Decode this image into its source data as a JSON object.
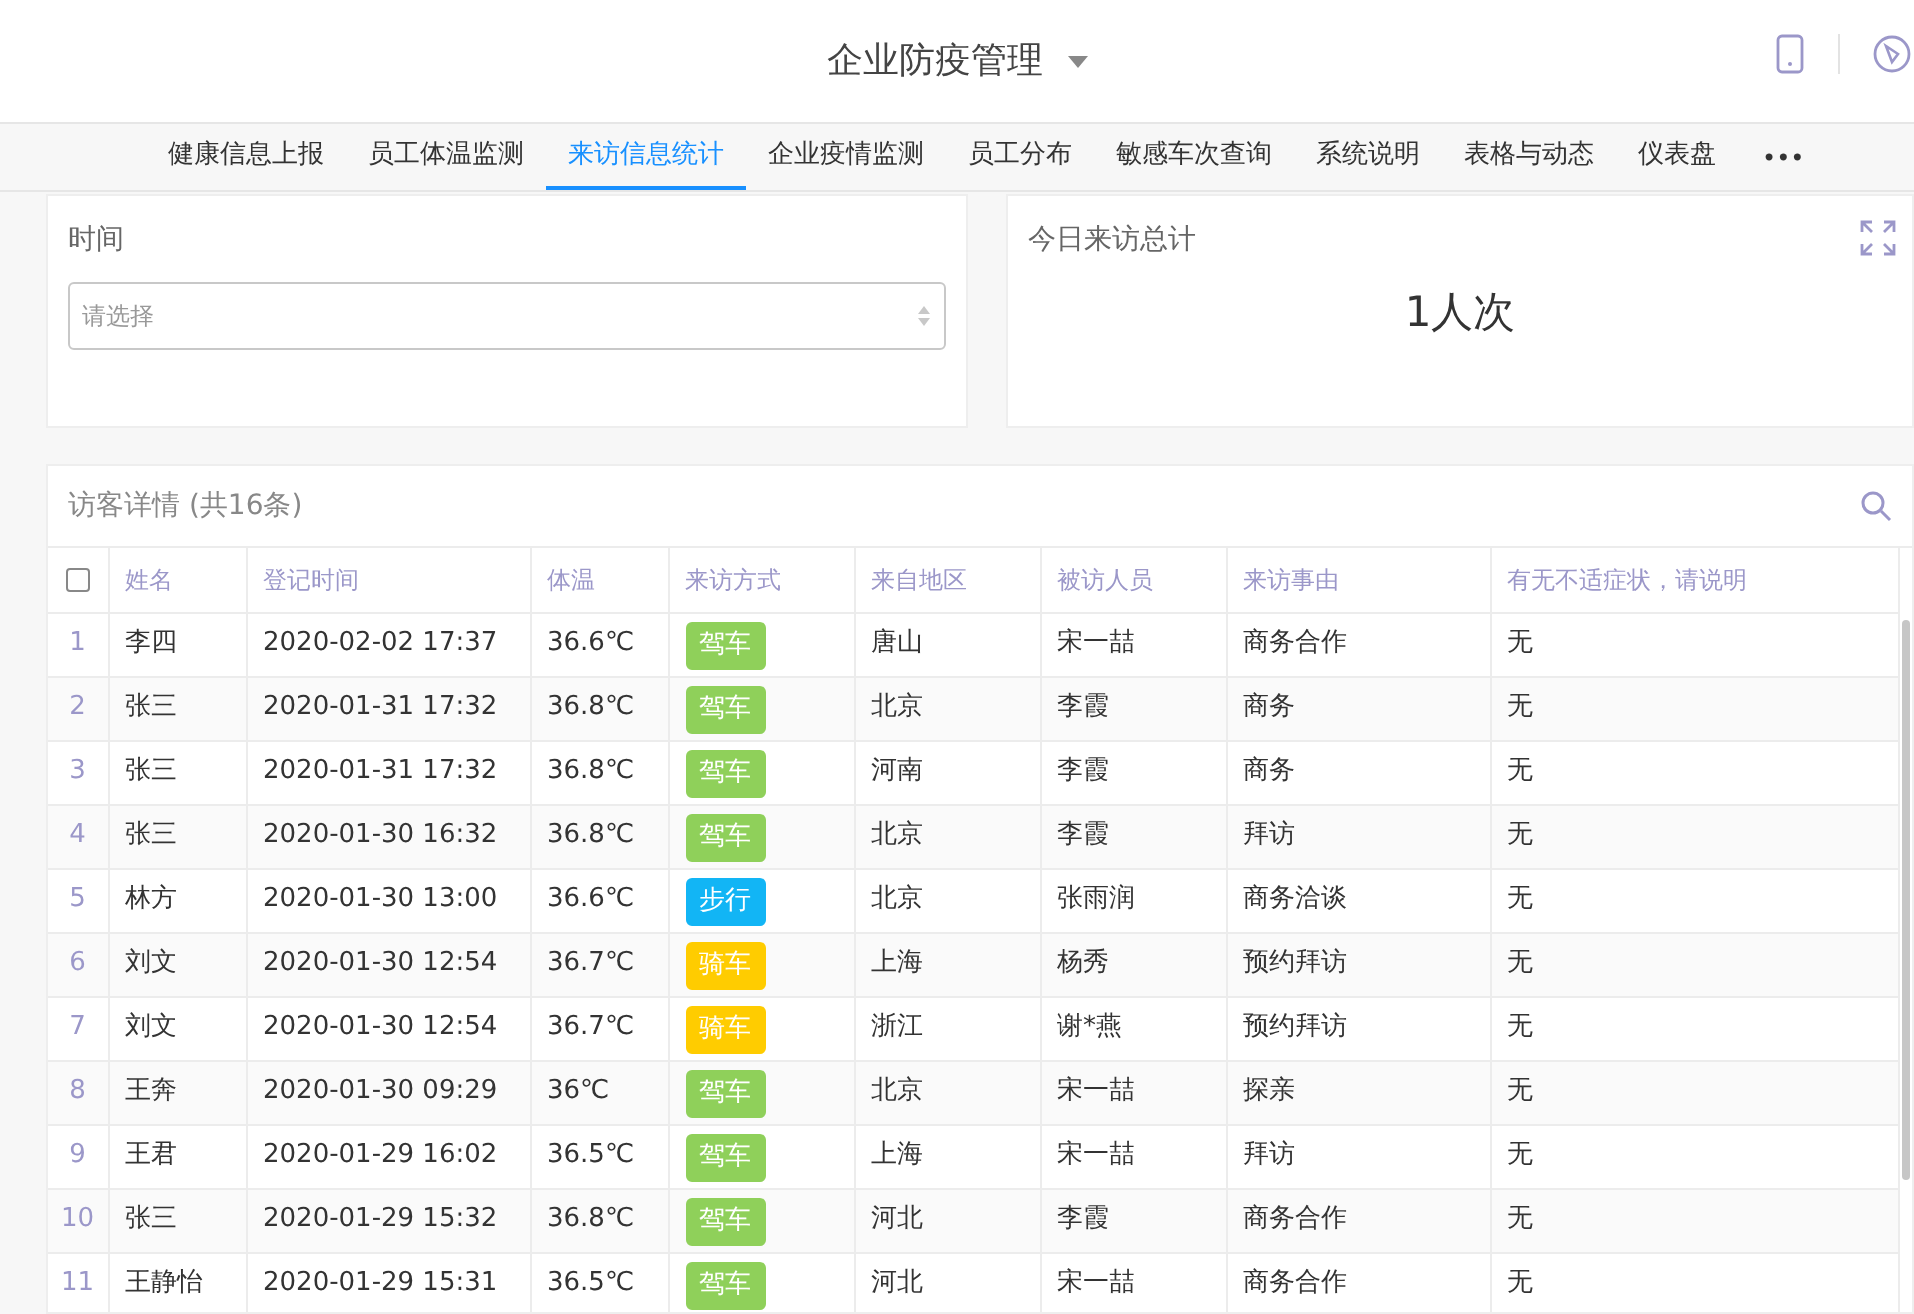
{
  "header": {
    "title": "企业防疫管理"
  },
  "tabs": [
    {
      "label": "健康信息上报",
      "selected": false
    },
    {
      "label": "员工体温监测",
      "selected": false
    },
    {
      "label": "来访信息统计",
      "selected": true
    },
    {
      "label": "企业疫情监测",
      "selected": false
    },
    {
      "label": "员工分布",
      "selected": false
    },
    {
      "label": "敏感车次查询",
      "selected": false
    },
    {
      "label": "系统说明",
      "selected": false
    },
    {
      "label": "表格与动态",
      "selected": false
    },
    {
      "label": "仪表盘",
      "selected": false
    }
  ],
  "more_tabs": "•••",
  "time_filter": {
    "label": "时间",
    "placeholder": "请选择"
  },
  "today_total": {
    "label": "今日来访总计",
    "value": "1人次"
  },
  "table": {
    "title": "访客详情 (共16条)",
    "select_all_checked": false,
    "columns": [
      "姓名",
      "登记时间",
      "体温",
      "来访方式",
      "来自地区",
      "被访人员",
      "来访事由",
      "有无不适症状，请说明"
    ],
    "rows": [
      {
        "index": "1",
        "name": "李四",
        "time": "2020-02-02 17:37",
        "temp": "36.6℃",
        "mode": {
          "label": "驾车",
          "color": "#8fd05a"
        },
        "region": "唐山",
        "host": "宋一喆",
        "reason": "商务合作",
        "symptom": "无"
      },
      {
        "index": "2",
        "name": "张三",
        "time": "2020-01-31 17:32",
        "temp": "36.8℃",
        "mode": {
          "label": "驾车",
          "color": "#8fd05a"
        },
        "region": "北京",
        "host": "李霞",
        "reason": "商务",
        "symptom": "无"
      },
      {
        "index": "3",
        "name": "张三",
        "time": "2020-01-31 17:32",
        "temp": "36.8℃",
        "mode": {
          "label": "驾车",
          "color": "#8fd05a"
        },
        "region": "河南",
        "host": "李霞",
        "reason": "商务",
        "symptom": "无"
      },
      {
        "index": "4",
        "name": "张三",
        "time": "2020-01-30 16:32",
        "temp": "36.8℃",
        "mode": {
          "label": "驾车",
          "color": "#8fd05a"
        },
        "region": "北京",
        "host": "李霞",
        "reason": "拜访",
        "symptom": "无"
      },
      {
        "index": "5",
        "name": "林方",
        "time": "2020-01-30 13:00",
        "temp": "36.6℃",
        "mode": {
          "label": "步行",
          "color": "#12b5f5"
        },
        "region": "北京",
        "host": "张雨润",
        "reason": "商务洽谈",
        "symptom": "无"
      },
      {
        "index": "6",
        "name": "刘文",
        "time": "2020-01-30 12:54",
        "temp": "36.7℃",
        "mode": {
          "label": "骑车",
          "color": "#ffcc00"
        },
        "region": "上海",
        "host": "杨秀",
        "reason": "预约拜访",
        "symptom": "无"
      },
      {
        "index": "7",
        "name": "刘文",
        "time": "2020-01-30 12:54",
        "temp": "36.7℃",
        "mode": {
          "label": "骑车",
          "color": "#ffcc00"
        },
        "region": "浙江",
        "host": "谢*燕",
        "reason": "预约拜访",
        "symptom": "无"
      },
      {
        "index": "8",
        "name": "王奔",
        "time": "2020-01-30 09:29",
        "temp": "36℃",
        "mode": {
          "label": "驾车",
          "color": "#8fd05a"
        },
        "region": "北京",
        "host": "宋一喆",
        "reason": "探亲",
        "symptom": "无"
      },
      {
        "index": "9",
        "name": "王君",
        "time": "2020-01-29 16:02",
        "temp": "36.5℃",
        "mode": {
          "label": "驾车",
          "color": "#8fd05a"
        },
        "region": "上海",
        "host": "宋一喆",
        "reason": "拜访",
        "symptom": "无"
      },
      {
        "index": "10",
        "name": "张三",
        "time": "2020-01-29 15:32",
        "temp": "36.8℃",
        "mode": {
          "label": "驾车",
          "color": "#8fd05a"
        },
        "region": "河北",
        "host": "李霞",
        "reason": "商务合作",
        "symptom": "无"
      },
      {
        "index": "11",
        "name": "王静怡",
        "time": "2020-01-29 15:31",
        "temp": "36.5℃",
        "mode": {
          "label": "驾车",
          "color": "#8fd05a"
        },
        "region": "河北",
        "host": "宋一喆",
        "reason": "商务合作",
        "symptom": "无"
      }
    ]
  }
}
